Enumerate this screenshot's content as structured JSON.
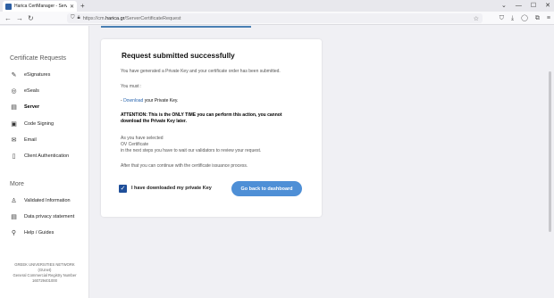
{
  "browser": {
    "tab_title": "Harica CertManager - Server C",
    "tab_close": "✕",
    "new_tab": "+",
    "url_prefix": "https://cm.",
    "url_domain": "harica.gr",
    "url_path": "/ServerCertificateRequest",
    "window_controls": [
      "⌄",
      "—",
      "☐",
      "✕"
    ]
  },
  "sidebar": {
    "section_requests": "Certificate Requests",
    "requests": [
      {
        "label": "eSignatures",
        "icon": "signature-icon",
        "glyph": "✎"
      },
      {
        "label": "eSeals",
        "icon": "seal-icon",
        "glyph": "◎"
      },
      {
        "label": "Server",
        "icon": "server-icon",
        "glyph": "▤"
      },
      {
        "label": "Code Signing",
        "icon": "code-icon",
        "glyph": "▣"
      },
      {
        "label": "Email",
        "icon": "email-icon",
        "glyph": "✉"
      },
      {
        "label": "Client Authentication",
        "icon": "client-auth-icon",
        "glyph": "▯"
      }
    ],
    "active_index": 2,
    "section_more": "More",
    "more": [
      {
        "label": "Validated Information",
        "icon": "validated-icon",
        "glyph": "♙"
      },
      {
        "label": "Data privacy statement",
        "icon": "privacy-icon",
        "glyph": "▤"
      },
      {
        "label": "Help / Guides",
        "icon": "help-icon",
        "glyph": "⚲"
      }
    ],
    "footer": {
      "line1": "GREEK UNIVERSITIES NETWORK",
      "line2": "(GUnet)",
      "line3": "General Commercial Registry Number",
      "line4": "160729401000"
    }
  },
  "card": {
    "title": "Request submitted successfully",
    "intro": "You have generated a Private Key and your certificate order has been submitted.",
    "must": "You must :",
    "download_prefix": "- ",
    "download_link": "Download",
    "download_suffix": " your Private Key.",
    "attention_line1": "ATTENTION: This is the ONLY TIME you can perform this action, you cannot",
    "attention_line2": "download the Private Key later.",
    "selected_line1": "As you have selected",
    "selected_line2": "OV Certificate",
    "selected_line3": "in the next steps you have to wait our validators to review your request.",
    "after": "After that you can continue with the certificate issuance process.",
    "checkbox_label": "I have downloaded my private Key",
    "checkbox_checked": true,
    "button_label": "Go back to dashboard"
  },
  "colors": {
    "accent": "#4e8fd6",
    "link": "#2a66b0",
    "checkbox": "#1f4f9a"
  }
}
